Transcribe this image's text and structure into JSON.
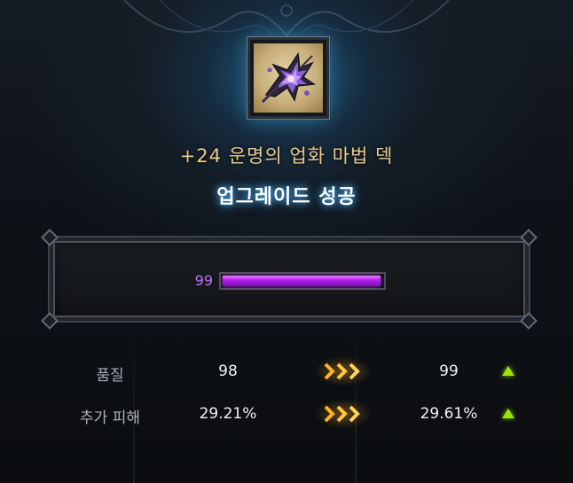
{
  "item": {
    "name": "+24 운명의 업화 마법 덱",
    "icon": "magic-deck-icon"
  },
  "result": "업그레이드 성공",
  "quality_gauge": {
    "value": "99",
    "fraction": 0.99,
    "color": "#b01ee8"
  },
  "stats": [
    {
      "label": "품질",
      "old": "98",
      "new": "99",
      "change": "up"
    },
    {
      "label": "추가 피해",
      "old": "29.21%",
      "new": "29.61%",
      "change": "up"
    }
  ],
  "colors": {
    "item_name": "#e8c98e",
    "result_glow": "#50beff",
    "gauge": "#b01ee8",
    "arrow": "#ffb21e",
    "increase": "#9be400"
  }
}
